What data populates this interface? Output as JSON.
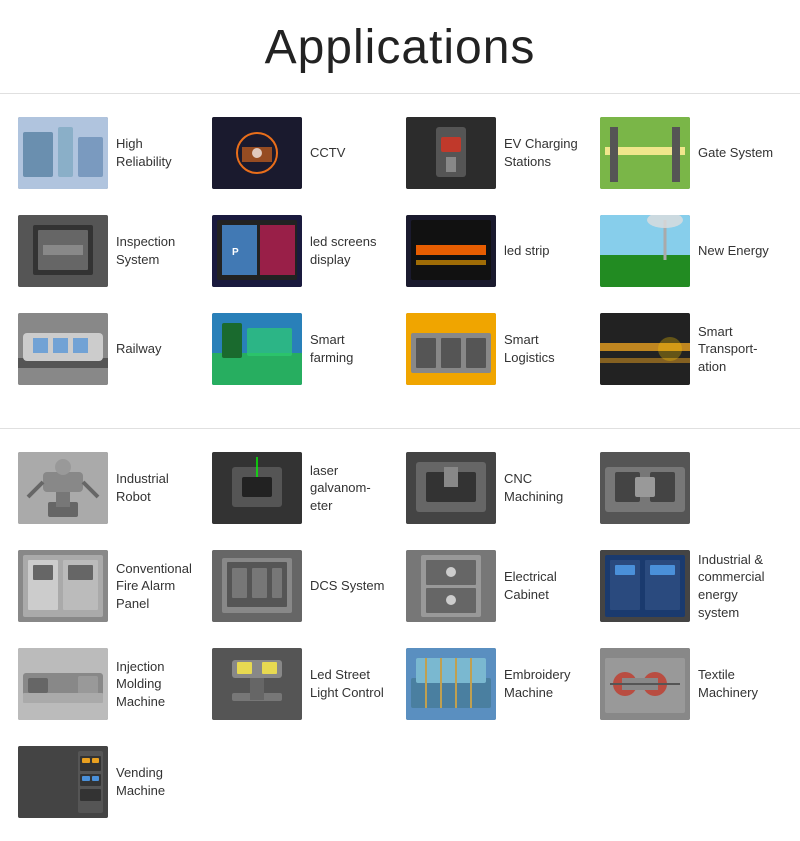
{
  "page": {
    "title": "Applications"
  },
  "sections": [
    {
      "id": "top",
      "items": [
        {
          "id": "high-reliability",
          "label": "High Reliability",
          "imgClass": "img-high-reliability"
        },
        {
          "id": "cctv",
          "label": "CCTV",
          "imgClass": "img-cctv"
        },
        {
          "id": "ev-charging",
          "label": "EV Charging Stations",
          "imgClass": "img-ev"
        },
        {
          "id": "gate-system",
          "label": "Gate System",
          "imgClass": "img-gate"
        },
        {
          "id": "inspection-system",
          "label": "Inspection System",
          "imgClass": "img-inspection"
        },
        {
          "id": "led-screens",
          "label": "led screens display",
          "imgClass": "img-led-screen"
        },
        {
          "id": "led-strip",
          "label": "led strip",
          "imgClass": "img-led-strip"
        },
        {
          "id": "new-energy",
          "label": "New Energy",
          "imgClass": "img-new-energy"
        },
        {
          "id": "railway",
          "label": "Railway",
          "imgClass": "img-railway"
        },
        {
          "id": "smart-farming",
          "label": "Smart farming",
          "imgClass": "img-smart-farming"
        },
        {
          "id": "smart-logistics",
          "label": "Smart Logistics",
          "imgClass": "img-smart-logistics"
        },
        {
          "id": "smart-transport",
          "label": "Smart Transport-ation",
          "imgClass": "img-smart-transport"
        }
      ]
    },
    {
      "id": "bottom",
      "items": [
        {
          "id": "industrial-robot",
          "label": "Industrial Robot",
          "imgClass": "img-industrial-robot"
        },
        {
          "id": "laser-galvano",
          "label": "laser galvanom-eter",
          "imgClass": "img-laser"
        },
        {
          "id": "cnc-machining",
          "label": "CNC Machining",
          "imgClass": "img-cnc"
        },
        {
          "id": "cnc-machine-img",
          "label": "",
          "imgClass": "img-cnc-machine"
        },
        {
          "id": "fire-alarm",
          "label": "Conventional Fire Alarm Panel",
          "imgClass": "img-fire-alarm"
        },
        {
          "id": "dcs-system",
          "label": "DCS System",
          "imgClass": "img-dcs"
        },
        {
          "id": "electrical-cabinet",
          "label": "Electrical Cabinet",
          "imgClass": "img-electrical"
        },
        {
          "id": "industrial-energy",
          "label": "Industrial & commercial energy system",
          "imgClass": "img-industrial-energy"
        },
        {
          "id": "injection-molding",
          "label": "Injection Molding Machine",
          "imgClass": "img-injection"
        },
        {
          "id": "led-street",
          "label": "Led Street Light Control",
          "imgClass": "img-led-street"
        },
        {
          "id": "embroidery",
          "label": "Embroidery Machine",
          "imgClass": "img-embroidery"
        },
        {
          "id": "textile",
          "label": "Textile Machinery",
          "imgClass": "img-textile"
        },
        {
          "id": "vending",
          "label": "Vending Machine",
          "imgClass": "img-vending"
        }
      ]
    }
  ]
}
